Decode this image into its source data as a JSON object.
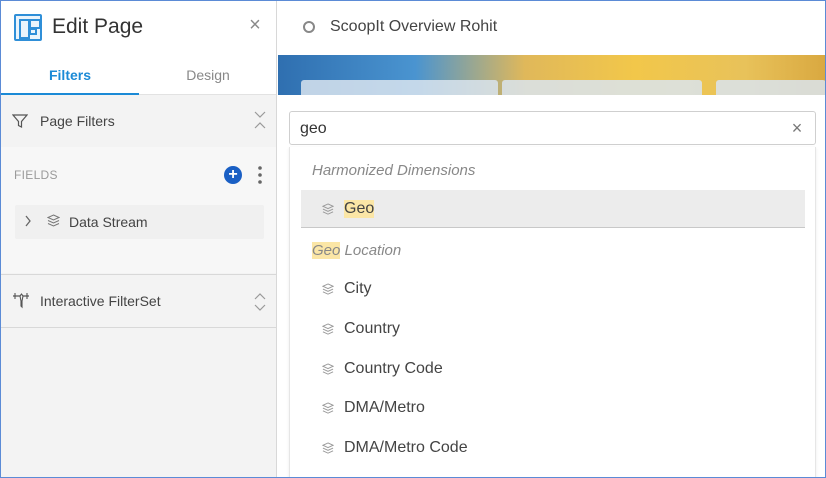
{
  "left_panel": {
    "title": "Edit Page",
    "tabs": [
      {
        "label": "Filters",
        "active": true
      },
      {
        "label": "Design",
        "active": false
      }
    ],
    "page_filters": {
      "title": "Page Filters",
      "fields_label": "FIELDS",
      "add_label": "+",
      "items": [
        {
          "label": "Data Stream"
        }
      ]
    },
    "interactive_filterset": {
      "title": "Interactive FilterSet"
    }
  },
  "right_panel": {
    "page_title": "ScoopIt Overview Rohit",
    "search": {
      "value": "geo"
    },
    "dropdown": {
      "groups": [
        {
          "label": "Harmonized Dimensions",
          "items": [
            {
              "label": "Geo",
              "selected": true
            }
          ]
        },
        {
          "label_highlight": "Geo",
          "label_rest": " Location",
          "items": [
            {
              "label": "City"
            },
            {
              "label": "Country"
            },
            {
              "label": "Country Code"
            },
            {
              "label": "DMA/Metro"
            },
            {
              "label": "DMA/Metro Code"
            }
          ]
        }
      ]
    }
  },
  "colors": {
    "accent": "#1b8ad6",
    "add_button": "#1a5fc4",
    "highlight": "#fbe6a6"
  },
  "icons": {
    "page": "page-layout-icon",
    "close": "close-icon",
    "filter": "filter-funnel-icon",
    "interactive": "interactive-filter-icon",
    "dimension": "cube-stack-icon"
  }
}
